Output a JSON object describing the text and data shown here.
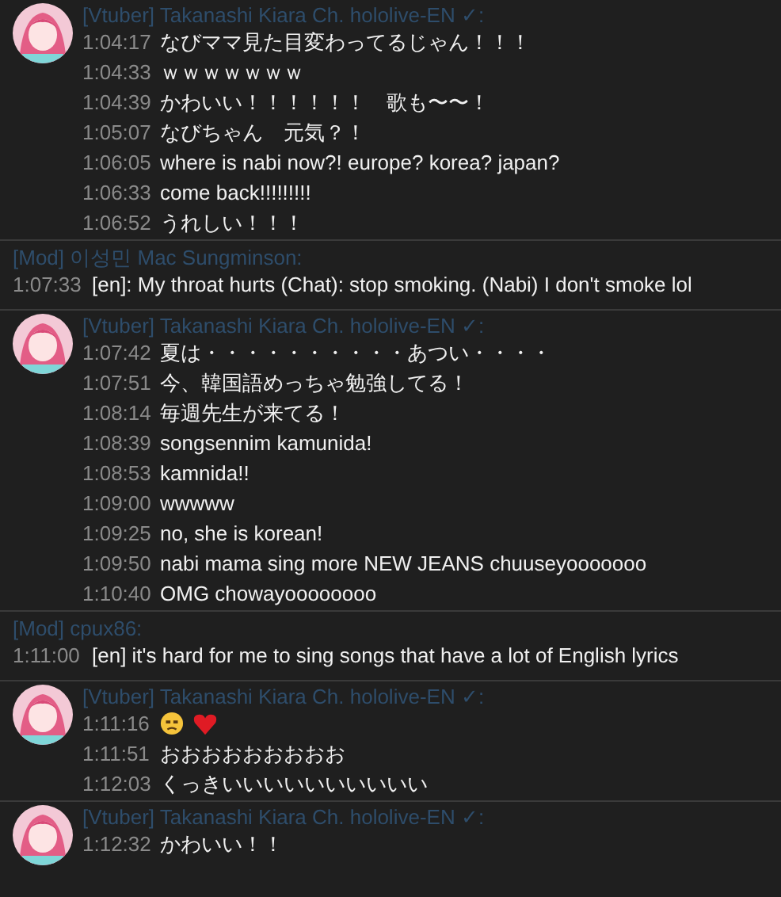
{
  "groups": [
    {
      "kind": "vtuber",
      "author": "[Vtuber] Takanashi Kiara Ch. hololive-EN ✓:",
      "messages": [
        {
          "time": "1:04:17",
          "text": "なびママ見た目変わってるじゃん！！！"
        },
        {
          "time": "1:04:33",
          "text": "ｗｗｗｗｗｗｗ"
        },
        {
          "time": "1:04:39",
          "text": "かわいい！！！！！！　歌も〜〜！"
        },
        {
          "time": "1:05:07",
          "text": "なびちゃん　元気？！"
        },
        {
          "time": "1:06:05",
          "text": "where is nabi now?! europe? korea? japan?"
        },
        {
          "time": "1:06:33",
          "text": "come back!!!!!!!!!"
        },
        {
          "time": "1:06:52",
          "text": "うれしい！！！"
        }
      ]
    },
    {
      "kind": "mod",
      "author": "[Mod] 이성민 Mac Sungminson:",
      "messages": [
        {
          "time": "1:07:33",
          "text": "[en]: My throat hurts (Chat): stop smoking. (Nabi) I don't smoke lol"
        }
      ]
    },
    {
      "kind": "vtuber",
      "author": "[Vtuber] Takanashi Kiara Ch. hololive-EN ✓:",
      "messages": [
        {
          "time": "1:07:42",
          "text": "夏は・・・・・・・・・・あつい・・・・"
        },
        {
          "time": "1:07:51",
          "text": "今、韓国語めっちゃ勉強してる！"
        },
        {
          "time": "1:08:14",
          "text": "毎週先生が来てる！"
        },
        {
          "time": "1:08:39",
          "text": "songsennim kamunida!"
        },
        {
          "time": "1:08:53",
          "text": "kamnida!!"
        },
        {
          "time": "1:09:00",
          "text": "wwwww"
        },
        {
          "time": "1:09:25",
          "text": "no, she is korean!"
        },
        {
          "time": "1:09:50",
          "text": "nabi mama sing more NEW JEANS chuuseyooooooo"
        },
        {
          "time": "1:10:40",
          "text": "OMG chowayoooooooo"
        }
      ]
    },
    {
      "kind": "mod",
      "author": "[Mod] cpux86:",
      "messages": [
        {
          "time": "1:11:00",
          "text": "[en] it's hard for me to sing songs that have a lot of English lyrics"
        }
      ]
    },
    {
      "kind": "vtuber",
      "author": "[Vtuber] Takanashi Kiara Ch. hololive-EN ✓:",
      "messages": [
        {
          "time": "1:11:16",
          "kind": "emoji"
        },
        {
          "time": "1:11:51",
          "text": "おおおおおおおおお"
        },
        {
          "time": "1:12:03",
          "text": "くっきいいいいいいいいいい"
        }
      ]
    },
    {
      "kind": "vtuber",
      "author": "[Vtuber] Takanashi Kiara Ch. hololive-EN ✓:",
      "messages": [
        {
          "time": "1:12:32",
          "text": "かわいい！！"
        }
      ]
    }
  ]
}
